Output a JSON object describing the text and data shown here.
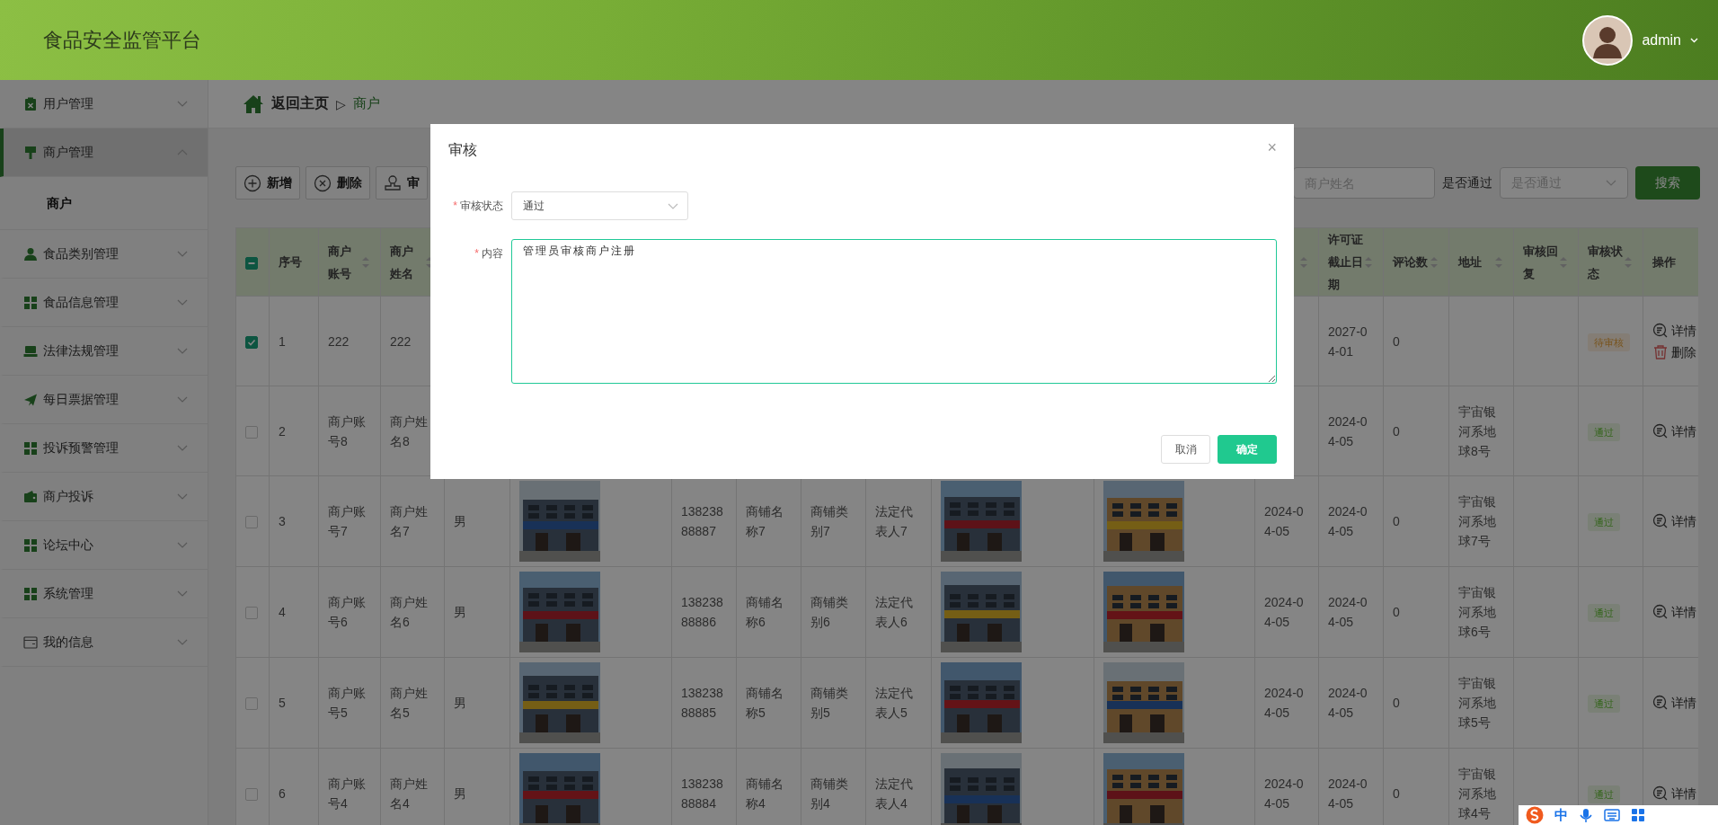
{
  "header": {
    "title": "食品安全监管平台",
    "user": "admin"
  },
  "sidebar": {
    "items": [
      {
        "label": "用户管理",
        "expanded": false,
        "selected": false
      },
      {
        "label": "商户管理",
        "expanded": true,
        "selected": true,
        "children": [
          {
            "label": "商户",
            "selected": true
          }
        ]
      },
      {
        "label": "食品类别管理",
        "expanded": false,
        "selected": false
      },
      {
        "label": "食品信息管理",
        "expanded": false,
        "selected": false
      },
      {
        "label": "法律法规管理",
        "expanded": false,
        "selected": false
      },
      {
        "label": "每日票据管理",
        "expanded": false,
        "selected": false
      },
      {
        "label": "投诉预警管理",
        "expanded": false,
        "selected": false
      },
      {
        "label": "商户投诉",
        "expanded": false,
        "selected": false
      },
      {
        "label": "论坛中心",
        "expanded": false,
        "selected": false
      },
      {
        "label": "系统管理",
        "expanded": false,
        "selected": false
      },
      {
        "label": "我的信息",
        "expanded": false,
        "selected": false
      }
    ]
  },
  "breadcrumb": {
    "home": "返回主页",
    "separator": "▷",
    "current": "商户"
  },
  "toolbar": {
    "buttons": [
      {
        "label": "新增",
        "kind": "add"
      },
      {
        "label": "删除",
        "kind": "delete"
      },
      {
        "label": "审",
        "kind": "audit"
      }
    ]
  },
  "search": {
    "name_placeholder": "商户姓名",
    "pass_label": "是否通过",
    "pass_placeholder": "是否通过",
    "button": "搜索"
  },
  "table": {
    "select_all": {
      "indeterminate": true
    },
    "columns": [
      {
        "kind": "checkbox"
      },
      {
        "label": "序号",
        "sortable": false
      },
      {
        "label": "商户账号",
        "sortable": true
      },
      {
        "label": "商户姓名",
        "sortable": true
      },
      null,
      null,
      null,
      null,
      null,
      null,
      null,
      null,
      {
        "sortable": true
      },
      {
        "label": "许可证截止日期",
        "sortable": true
      },
      {
        "label": "评论数",
        "sortable": true
      },
      {
        "label": "地址",
        "sortable": true
      },
      {
        "label": "审核回复",
        "sortable": true
      },
      {
        "label": "审核状态",
        "sortable": true
      },
      {
        "label": "操作",
        "sortable": false
      }
    ],
    "rows": [
      {
        "cells": [
          {
            "kind": "checkbox",
            "checked": true
          },
          "1",
          "222",
          "222",
          null,
          null,
          null,
          null,
          null,
          null,
          null,
          null,
          null,
          "2027-04-01",
          "0",
          null,
          null,
          {
            "kind": "pending",
            "text": "待审核"
          },
          {
            "kind": "actions",
            "items": [
              {
                "label": "详情",
                "kind": "detail"
              },
              {
                "label": "删除",
                "kind": "delete"
              }
            ]
          }
        ]
      },
      {
        "cells": [
          {
            "kind": "checkbox",
            "checked": false
          },
          "2",
          "商户账号8",
          "商户姓名8",
          null,
          null,
          null,
          null,
          null,
          null,
          null,
          null,
          null,
          "2024-04-05",
          "0",
          "宇宙银河系地球8号",
          null,
          {
            "kind": "approved",
            "text": "通过"
          },
          {
            "kind": "actions",
            "items": [
              {
                "label": "详情",
                "kind": "detail"
              }
            ]
          }
        ]
      },
      {
        "cells": [
          {
            "kind": "checkbox",
            "checked": false
          },
          "3",
          "商户账号7",
          "商户姓名7",
          "男",
          {
            "kind": "picture"
          },
          "13823888887",
          "商铺名称7",
          "商铺类别7",
          "法定代表人7",
          {
            "kind": "picture"
          },
          {
            "kind": "picture"
          },
          "2024-04-05",
          "2024-04-05",
          "0",
          "宇宙银河系地球7号",
          null,
          {
            "kind": "approved",
            "text": "通过"
          },
          {
            "kind": "actions",
            "items": [
              {
                "label": "详情",
                "kind": "detail"
              }
            ]
          }
        ]
      },
      {
        "cells": [
          {
            "kind": "checkbox",
            "checked": false
          },
          "4",
          "商户账号6",
          "商户姓名6",
          "男",
          {
            "kind": "picture"
          },
          "13823888886",
          "商铺名称6",
          "商铺类别6",
          "法定代表人6",
          {
            "kind": "picture"
          },
          {
            "kind": "picture"
          },
          "2024-04-05",
          "2024-04-05",
          "0",
          "宇宙银河系地球6号",
          null,
          {
            "kind": "approved",
            "text": "通过"
          },
          {
            "kind": "actions",
            "items": [
              {
                "label": "详情",
                "kind": "detail"
              }
            ]
          }
        ]
      },
      {
        "cells": [
          {
            "kind": "checkbox",
            "checked": false
          },
          "5",
          "商户账号5",
          "商户姓名5",
          "男",
          {
            "kind": "picture"
          },
          "13823888885",
          "商铺名称5",
          "商铺类别5",
          "法定代表人5",
          {
            "kind": "picture"
          },
          {
            "kind": "picture"
          },
          "2024-04-05",
          "2024-04-05",
          "0",
          "宇宙银河系地球5号",
          null,
          {
            "kind": "approved",
            "text": "通过"
          },
          {
            "kind": "actions",
            "items": [
              {
                "label": "详情",
                "kind": "detail"
              }
            ]
          }
        ]
      },
      {
        "cells": [
          {
            "kind": "checkbox",
            "checked": false
          },
          "6",
          "商户账号4",
          "商户姓名4",
          "男",
          {
            "kind": "picture"
          },
          "13823888884",
          "商铺名称4",
          "商铺类别4",
          "法定代表人4",
          {
            "kind": "picture"
          },
          {
            "kind": "picture"
          },
          "2024-04-05",
          "2024-04-05",
          "0",
          "宇宙银河系地球4号",
          null,
          {
            "kind": "approved",
            "text": "通过"
          },
          {
            "kind": "actions",
            "items": [
              {
                "label": "详情",
                "kind": "detail"
              }
            ]
          }
        ]
      }
    ]
  },
  "dialog": {
    "title": "审核",
    "close": "×",
    "fields": [
      {
        "label": "审核状态",
        "required_mark": "*",
        "kind": "select",
        "value": "通过"
      },
      {
        "label": "内容",
        "required_mark": "*",
        "kind": "textarea",
        "value": "管理员审核商户注册",
        "focused": true
      }
    ],
    "buttons": [
      {
        "label": "取消",
        "kind": "default"
      },
      {
        "label": "确定",
        "kind": "primary"
      }
    ]
  },
  "ime_toolbar": {
    "mode": "中"
  }
}
